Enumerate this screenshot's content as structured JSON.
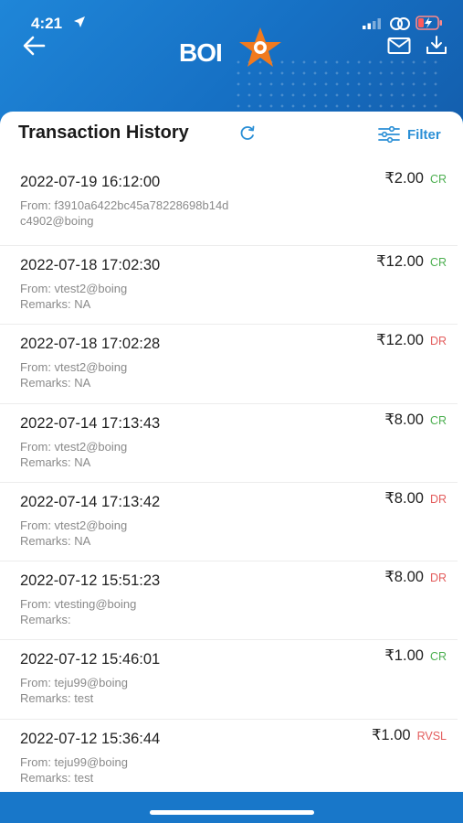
{
  "status_bar": {
    "time": "4:21"
  },
  "header": {
    "logo_text": "BOI"
  },
  "page": {
    "title": "Transaction History",
    "filter_label": "Filter"
  },
  "transactions": [
    {
      "datetime": "2022-07-19 16:12:00",
      "amount": "₹2.00",
      "type": "CR",
      "from": "From: f3910a6422bc45a78228698b14dc4902@boing",
      "remarks": ""
    },
    {
      "datetime": "2022-07-18 17:02:30",
      "amount": "₹12.00",
      "type": "CR",
      "from": "From: vtest2@boing",
      "remarks": "Remarks: NA"
    },
    {
      "datetime": "2022-07-18 17:02:28",
      "amount": "₹12.00",
      "type": "DR",
      "from": "From: vtest2@boing",
      "remarks": "Remarks: NA"
    },
    {
      "datetime": "2022-07-14 17:13:43",
      "amount": "₹8.00",
      "type": "CR",
      "from": "From: vtest2@boing",
      "remarks": "Remarks: NA"
    },
    {
      "datetime": "2022-07-14 17:13:42",
      "amount": "₹8.00",
      "type": "DR",
      "from": "From: vtest2@boing",
      "remarks": "Remarks: NA"
    },
    {
      "datetime": "2022-07-12 15:51:23",
      "amount": "₹8.00",
      "type": "DR",
      "from": "From: vtesting@boing",
      "remarks": "Remarks:"
    },
    {
      "datetime": "2022-07-12 15:46:01",
      "amount": "₹1.00",
      "type": "CR",
      "from": "From: teju99@boing",
      "remarks": "Remarks: test"
    },
    {
      "datetime": "2022-07-12 15:36:44",
      "amount": "₹1.00",
      "type": "RVSL",
      "from": "From: teju99@boing",
      "remarks": "Remarks: test"
    }
  ],
  "colors": {
    "header_blue": "#1877c9",
    "credit": "#4caf50",
    "debit": "#e35d5d",
    "accent": "#2a8fd6",
    "logo_star": "#f07a1f"
  }
}
